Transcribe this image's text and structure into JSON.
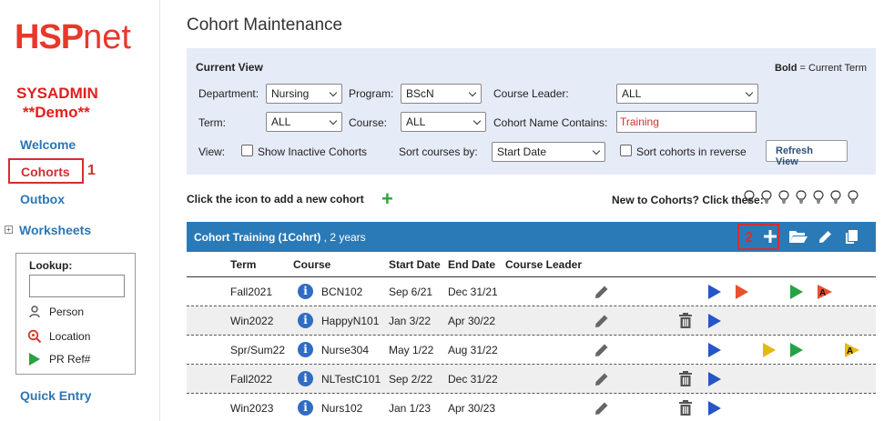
{
  "sidebar": {
    "logo_main": "HSP",
    "logo_net": "net",
    "user": "SYSADMIN",
    "env": "**Demo**",
    "nav": {
      "welcome": "Welcome",
      "cohorts": "Cohorts",
      "outbox": "Outbox",
      "worksheets": "Worksheets",
      "quick_entry": "Quick Entry"
    },
    "annotation_1": "1",
    "lookup": {
      "title": "Lookup:",
      "input_value": "",
      "person": "Person",
      "location": "Location",
      "pr_ref": "PR Ref#"
    }
  },
  "main": {
    "title": "Cohort Maintenance",
    "current_view": {
      "title": "Current View",
      "note_bold": "Bold",
      "note_rest": " = Current Term",
      "department_label": "Department:",
      "department_value": "Nursing",
      "program_label": "Program:",
      "program_value": "BScN",
      "course_leader_label": "Course Leader:",
      "course_leader_value": "ALL",
      "term_label": "Term:",
      "term_value": "ALL",
      "course_label": "Course:",
      "course_value": "ALL",
      "cohort_name_label": "Cohort Name Contains:",
      "cohort_name_value": "Training",
      "view_label": "View:",
      "show_inactive_label": "Show Inactive Cohorts",
      "sort_courses_label": "Sort courses by:",
      "sort_courses_value": "Start Date",
      "sort_reverse_label": "Sort cohorts in reverse",
      "refresh_button": "Refresh View"
    },
    "add_cohort_text": "Click the icon to add a new cohort",
    "new_to_cohorts_text": "New to Cohorts? Click these:",
    "cohort_bar": {
      "name": "Cohort Training (1Cohrt)",
      "suffix": " , 2 years",
      "annotation_2": "2"
    },
    "table": {
      "headers": {
        "term": "Term",
        "course": "Course",
        "start": "Start Date",
        "end": "End Date",
        "leader": "Course Leader"
      },
      "rows": [
        {
          "term": "Fall2021",
          "course": "BCN102",
          "start": "Sep 6/21",
          "end": "Dec 31/21"
        },
        {
          "term": "Win2022",
          "course": "HappyN101",
          "start": "Jan 3/22",
          "end": "Apr 30/22"
        },
        {
          "term": "Spr/Sum22",
          "course": "Nurse304",
          "start": "May 1/22",
          "end": "Aug 31/22"
        },
        {
          "term": "Fall2022",
          "course": "NLTestC101",
          "start": "Sep 2/22",
          "end": "Dec 31/22"
        },
        {
          "term": "Win2023",
          "course": "Nurs102",
          "start": "Jan 1/23",
          "end": "Apr 30/23"
        }
      ]
    }
  },
  "colors": {
    "brand_red": "#e8382c",
    "link_blue": "#2a77b5",
    "bar_blue": "#2a7ab8",
    "add_green": "#2fa43a",
    "play_blue": "#2456c6",
    "play_red": "#e8502c",
    "play_green": "#27a243",
    "play_yellow": "#e8b90c"
  },
  "icons": [
    "search-icon",
    "person-icon",
    "location-icon",
    "play-icon",
    "plus-icon",
    "folder-icon",
    "pencil-icon",
    "copy-icon",
    "lightbulb-icon",
    "info-icon",
    "trash-icon"
  ]
}
